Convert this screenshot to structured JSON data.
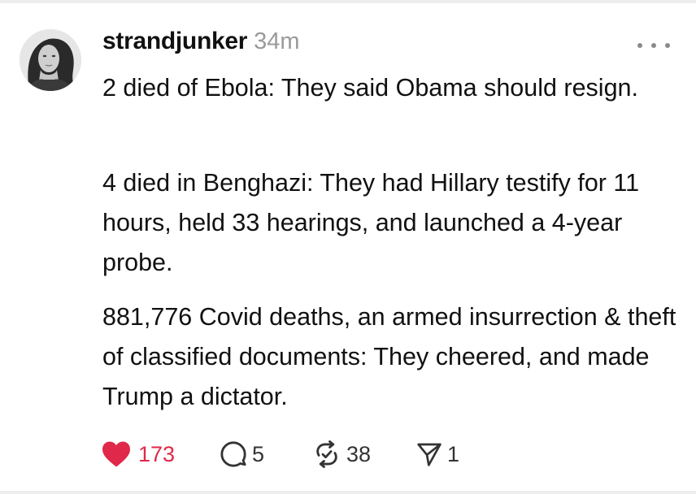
{
  "post": {
    "author": "strandjunker",
    "timestamp": "34m",
    "paragraphs": [
      "2 died of Ebola: They said Obama should resign.",
      "4 died in Benghazi: They had Hillary testify for 11 hours, held 33 hearings, and launched a 4-year probe.",
      "881,776 Covid deaths, an armed insurrection & theft of classified documents: They cheered, and made Trump a dictator."
    ],
    "actions": {
      "likes": "173",
      "replies": "5",
      "reposts": "38",
      "shares": "1"
    },
    "liked": true
  },
  "colors": {
    "like": "#e0284a",
    "timestamp": "#9a9a9a",
    "text": "#111111",
    "icon": "#333333"
  },
  "icons": {
    "more": "more-horizontal-icon",
    "like": "heart-icon",
    "reply": "comment-icon",
    "repost": "repost-icon",
    "share": "send-icon"
  }
}
